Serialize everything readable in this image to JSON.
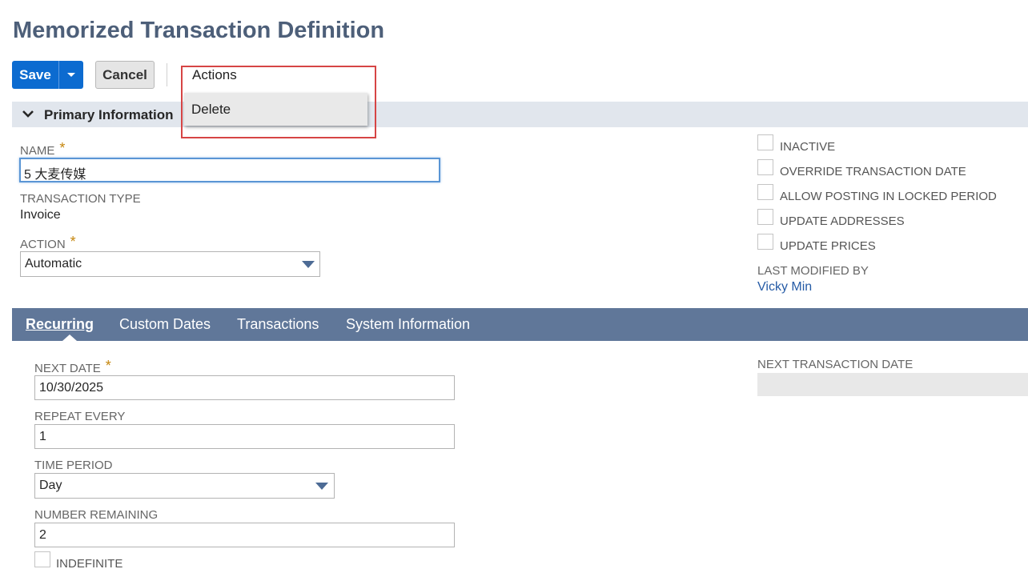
{
  "page": {
    "title": "Memorized Transaction Definition"
  },
  "toolbar": {
    "save_label": "Save",
    "cancel_label": "Cancel",
    "actions_label": "Actions",
    "actions_menu": [
      "Delete"
    ],
    "save_arrow_icon": "caret-down-icon"
  },
  "colors": {
    "primary_button": "#0c6bd0",
    "title": "#4d5f79",
    "tab_bar": "#607799",
    "section_bar": "#e1e6ed",
    "required_marker": "#c5860d",
    "link": "#255ba6",
    "annotation_box": "#d64545"
  },
  "primary": {
    "section_title": "Primary Information",
    "section_icon": "chevron-down-icon",
    "name_label": "NAME",
    "name_required": "*",
    "name_value": "5 大麦传媒",
    "transaction_type_label": "TRANSACTION TYPE",
    "transaction_type_value": "Invoice",
    "action_label": "ACTION",
    "action_required": "*",
    "action_value": "Automatic"
  },
  "checkboxes": [
    {
      "label": "INACTIVE",
      "checked": false
    },
    {
      "label": "OVERRIDE TRANSACTION DATE",
      "checked": false
    },
    {
      "label": "ALLOW POSTING IN LOCKED PERIOD",
      "checked": false
    },
    {
      "label": "UPDATE ADDRESSES",
      "checked": false
    },
    {
      "label": "UPDATE PRICES",
      "checked": false
    }
  ],
  "last_modified": {
    "label": "LAST MODIFIED BY",
    "value": "Vicky Min"
  },
  "tabs": [
    {
      "label": "Recurring",
      "active": true
    },
    {
      "label": "Custom Dates",
      "active": false
    },
    {
      "label": "Transactions",
      "active": false
    },
    {
      "label": "System Information",
      "active": false
    }
  ],
  "recurring": {
    "next_date_label": "NEXT DATE",
    "next_date_required": "*",
    "next_date_value": "10/30/2025",
    "repeat_every_label": "REPEAT EVERY",
    "repeat_every_value": "1",
    "time_period_label": "TIME PERIOD",
    "time_period_value": "Day",
    "number_remaining_label": "NUMBER REMAINING",
    "number_remaining_value": "2",
    "indefinite_label": "INDEFINITE",
    "indefinite_checked": false,
    "next_transaction_date_label": "NEXT TRANSACTION DATE",
    "next_transaction_date_value": ""
  }
}
